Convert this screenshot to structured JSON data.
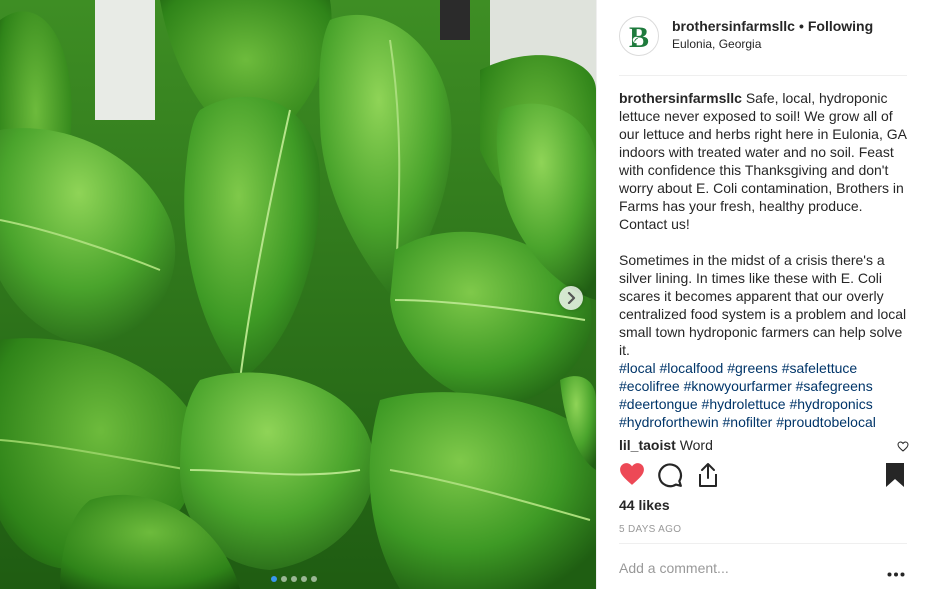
{
  "post": {
    "username": "brothersinfarmsllc",
    "separator": "•",
    "follow_status": "Following",
    "location": "Eulonia, Georgia",
    "avatar_letter": "B",
    "brand_color": "#1e7a3c"
  },
  "caption": {
    "username": "brothersinfarmsllc",
    "paragraph1": "Safe, local, hydroponic lettuce never exposed to soil! We grow all of our lettuce and herbs right here in Eulonia, GA indoors with treated water and no soil. Feast with confidence this Thanksgiving and don't worry about E. Coli contamination, Brothers in Farms has your fresh, healthy produce. Contact us!",
    "paragraph2": "Sometimes in the midst of a crisis there's a silver lining. In times like these with E. Coli scares it becomes apparent that our overly centralized food system is a problem and local small town hydroponic farmers can help solve it.",
    "hashtags": [
      "#local",
      "#localfood",
      "#greens",
      "#safelettuce",
      "#ecolifree",
      "#knowyourfarmer",
      "#safegreens",
      "#deertongue",
      "#hydrolettuce",
      "#hydroponics",
      "#hydroforthewin",
      "#nofilter",
      "#proudtobelocal"
    ]
  },
  "comment": {
    "username": "lil_taoist",
    "text": "Word"
  },
  "actions": {
    "like_icon": "heart-icon",
    "comment_icon": "comment-icon",
    "share_icon": "share-icon",
    "save_icon": "bookmark-icon",
    "liked_color": "#ed4956"
  },
  "likes": "44 likes",
  "timestamp": "5 DAYS AGO",
  "comment_box": {
    "placeholder": "Add a comment...",
    "more_icon": "more-icon"
  },
  "carousel": {
    "slide_count": 5,
    "active_index": 0,
    "next_icon": "chevron-right-icon",
    "active_color": "#3897f0"
  }
}
